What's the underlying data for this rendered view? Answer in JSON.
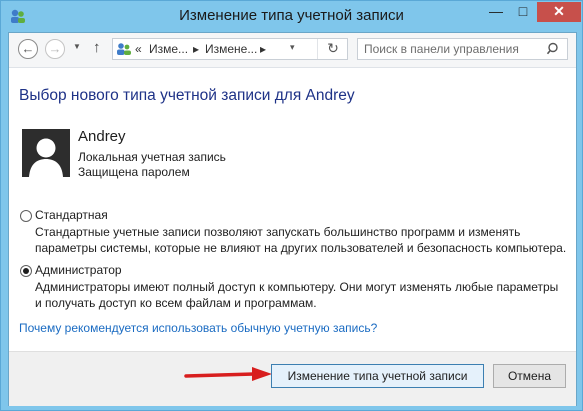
{
  "window": {
    "title": "Изменение типа учетной записи",
    "min_glyph": "—",
    "max_glyph": "□",
    "close_glyph": "✕",
    "accent": "#7fc6eb",
    "close_color": "#c7504b"
  },
  "nav": {
    "back_glyph": "←",
    "forward_glyph": "→",
    "history_glyph": "▼",
    "up_glyph": "↑",
    "breadcrumb": [
      "«",
      "Изме...",
      "▸",
      "Измене...",
      "▸"
    ],
    "dropdown_glyph": "▾",
    "refresh_glyph": "↻",
    "search_placeholder": "Поиск в панели управления"
  },
  "main": {
    "page_title": "Выбор нового типа учетной записи для Andrey",
    "user": {
      "name": "Andrey",
      "account_type": "Локальная учетная запись",
      "protection": "Защищена паролем"
    },
    "options": [
      {
        "label": "Стандартная",
        "checked": false,
        "desc_line1": "Стандартные учетные записи позволяют запускать большинство программ и изменять",
        "desc_line2": "параметры системы, которые не влияют на других пользователей и безопасность компьютера."
      },
      {
        "label": "Администратор",
        "checked": true,
        "desc_line1": "Администраторы имеют полный доступ к компьютеру. Они могут изменять любые параметры",
        "desc_line2": "и получать доступ ко всем файлам и программам."
      }
    ],
    "help_link": "Почему рекомендуется использовать обычную учетную запись?",
    "link_color": "#1a6bc2",
    "title_color": "#1e3287"
  },
  "footer": {
    "primary_button": "Изменение типа учетной записи",
    "cancel_button": "Отмена",
    "arrow_color": "#d81e1e"
  },
  "icons": [
    "control-panel-icon",
    "user-accounts-icon",
    "refresh-icon",
    "search-icon",
    "avatar-silhouette",
    "red-arrow"
  ]
}
